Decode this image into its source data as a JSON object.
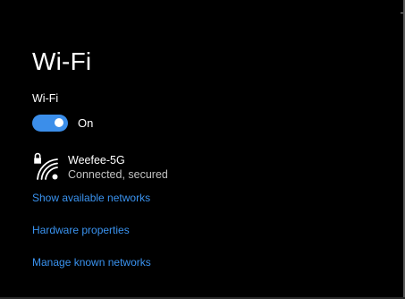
{
  "page": {
    "title": "Wi-Fi"
  },
  "wifi": {
    "section_label": "Wi-Fi",
    "toggle": {
      "state": "On",
      "is_on": true
    }
  },
  "network": {
    "name": "Weefee-5G",
    "status": "Connected, secured",
    "icons": [
      "lock-icon",
      "wifi-signal-icon"
    ]
  },
  "links": {
    "show_available": "Show available networks",
    "hardware_properties": "Hardware properties",
    "manage_known": "Manage known networks"
  },
  "colors": {
    "background": "#000000",
    "accent": "#3b8eea",
    "link": "#3a93f0",
    "text": "#ffffff",
    "secondary_text": "#c2c2c2"
  }
}
